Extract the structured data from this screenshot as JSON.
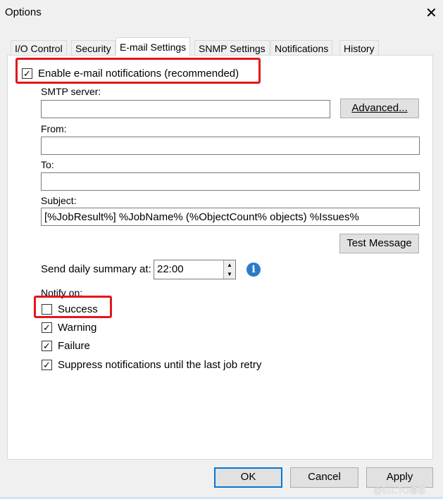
{
  "window": {
    "title": "Options"
  },
  "tabs": [
    "I/O Control",
    "Security",
    "E-mail Settings",
    "SNMP Settings",
    "Notifications",
    "History"
  ],
  "active_tab": "E-mail Settings",
  "email": {
    "enable_label": "Enable e-mail notifications (recommended)",
    "enable_checked": true,
    "smtp_label": "SMTP server:",
    "smtp_value": "",
    "advanced_label": "Advanced...",
    "from_label": "From:",
    "from_value": "",
    "to_label": "To:",
    "to_value": "",
    "subject_label": "Subject:",
    "subject_value": "[%JobResult%] %JobName% (%ObjectCount% objects) %Issues%",
    "test_label": "Test Message",
    "summary_label": "Send daily summary at:",
    "summary_time": "22:00",
    "notify_label": "Notify on:",
    "options": [
      {
        "label": "Success",
        "checked": false
      },
      {
        "label": "Warning",
        "checked": true
      },
      {
        "label": "Failure",
        "checked": true
      },
      {
        "label": "Suppress notifications until the last job retry",
        "checked": true
      }
    ]
  },
  "buttons": {
    "ok": "OK",
    "cancel": "Cancel",
    "apply": "Apply"
  },
  "watermark": "@51CTO博客"
}
